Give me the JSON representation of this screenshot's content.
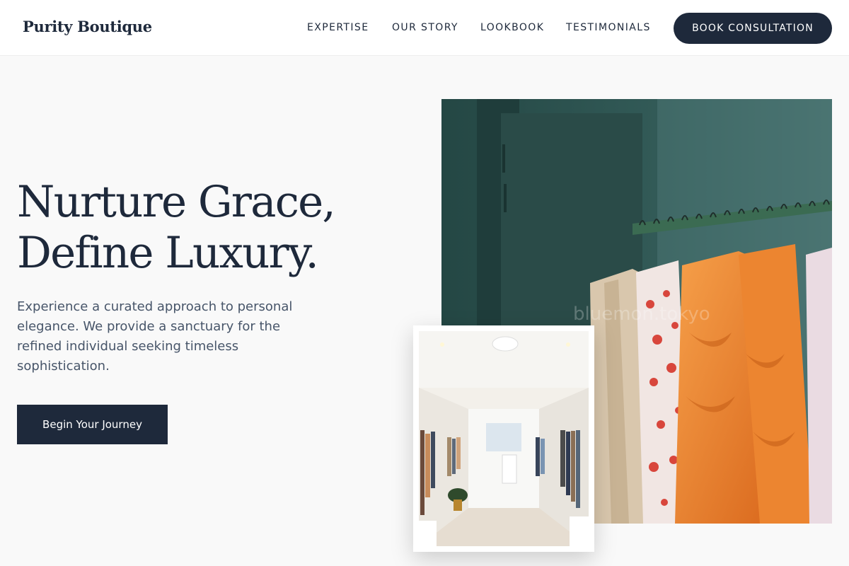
{
  "brand": {
    "name": "Purity Boutique"
  },
  "nav": {
    "links": [
      {
        "label": "EXPERTISE"
      },
      {
        "label": "OUR STORY"
      },
      {
        "label": "LOOKBOOK"
      },
      {
        "label": "TESTIMONIALS"
      }
    ],
    "cta_label": "BOOK CONSULTATION"
  },
  "hero": {
    "title_line1": "Nurture Grace,",
    "title_line2": "Define Luxury.",
    "subtitle": "Experience a curated approach to personal elegance. We provide a sanctuary for the refined individual seeking timeless sophistication.",
    "button_label": "Begin Your Journey"
  },
  "images": {
    "main": {
      "subject": "clothing-rack-photo",
      "watermark": "bluemon.tokyo"
    },
    "inset": {
      "subject": "boutique-interior-photo"
    }
  },
  "colors": {
    "primary": "#1e293b",
    "background": "#f9f9f9",
    "text_muted": "#475569",
    "accent_orange": "#f28a2e",
    "wall_teal": "#2c4e4b"
  }
}
